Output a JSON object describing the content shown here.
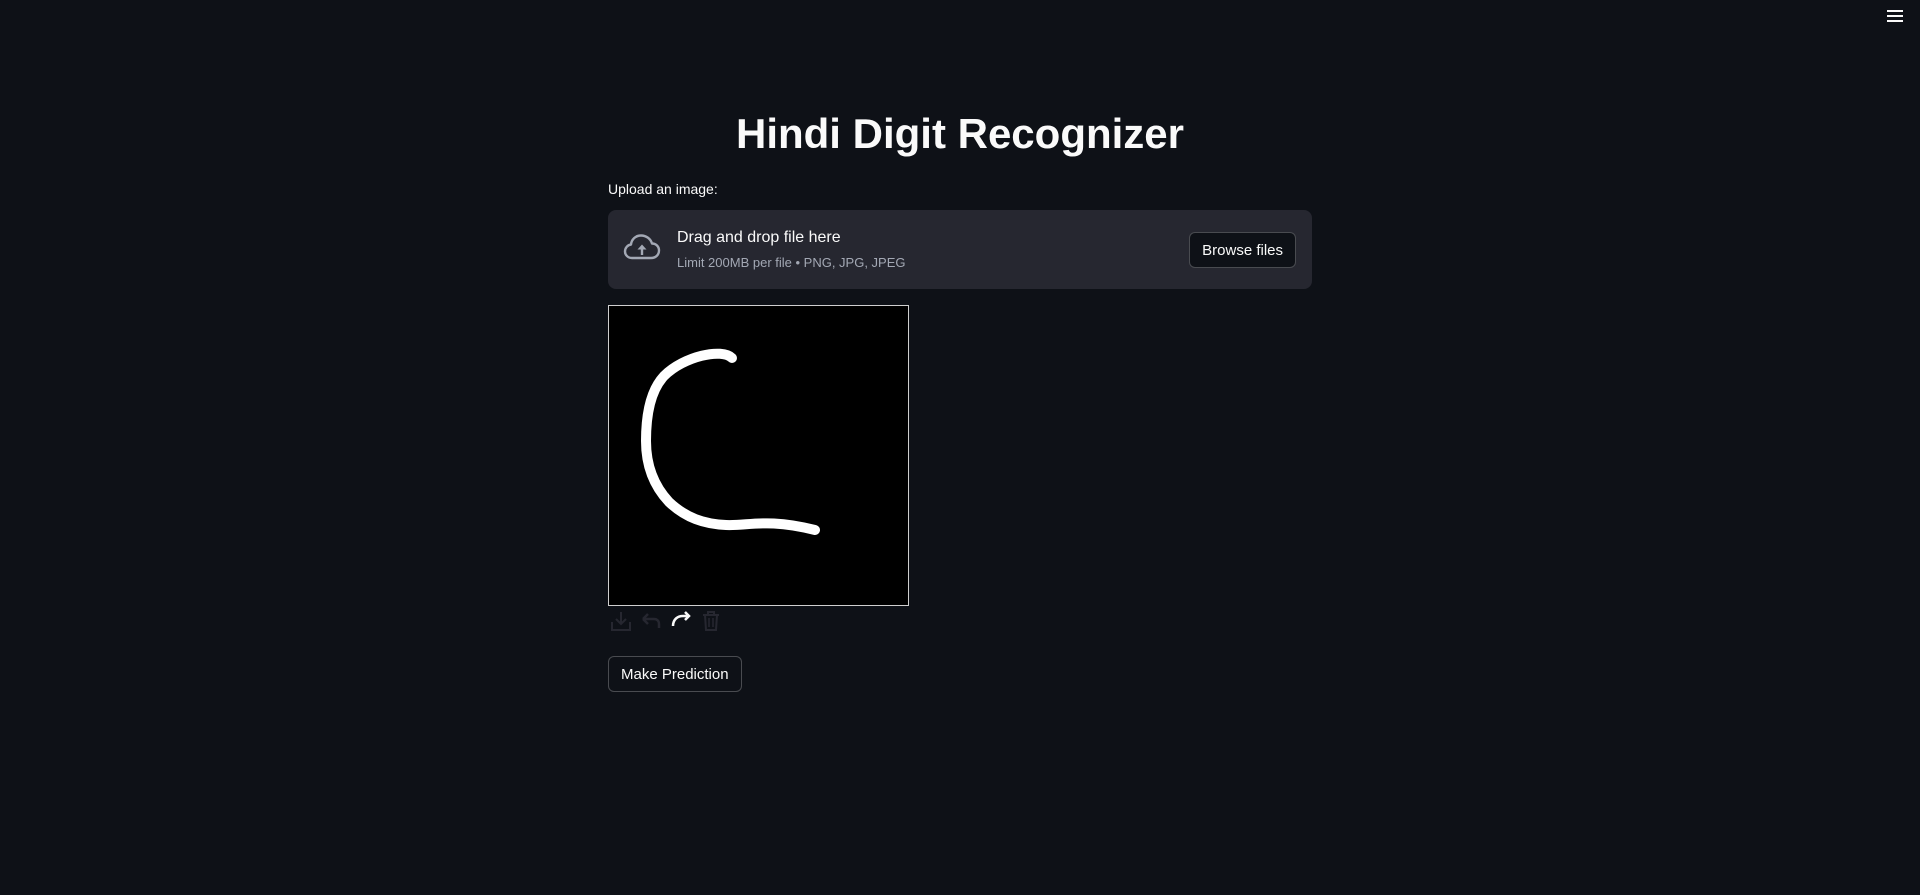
{
  "header": {
    "menu_icon": "hamburger-menu-icon"
  },
  "main": {
    "title": "Hindi Digit Recognizer",
    "uploader": {
      "label": "Upload an image:",
      "drop_title": "Drag and drop file here",
      "limit_text": "Limit 200MB per file • PNG, JPG, JPEG",
      "browse_label": "Browse files",
      "icon": "cloud-upload-icon"
    },
    "canvas": {
      "background": "#000000",
      "stroke_color": "#ffffff"
    },
    "toolbar": {
      "icons": [
        "download-icon",
        "undo-icon",
        "redo-icon",
        "trash-icon"
      ]
    },
    "predict_label": "Make Prediction"
  },
  "colors": {
    "background": "#0e1117",
    "panel": "#262730",
    "text": "#fafafa",
    "muted_text": "#a3a8b4"
  }
}
